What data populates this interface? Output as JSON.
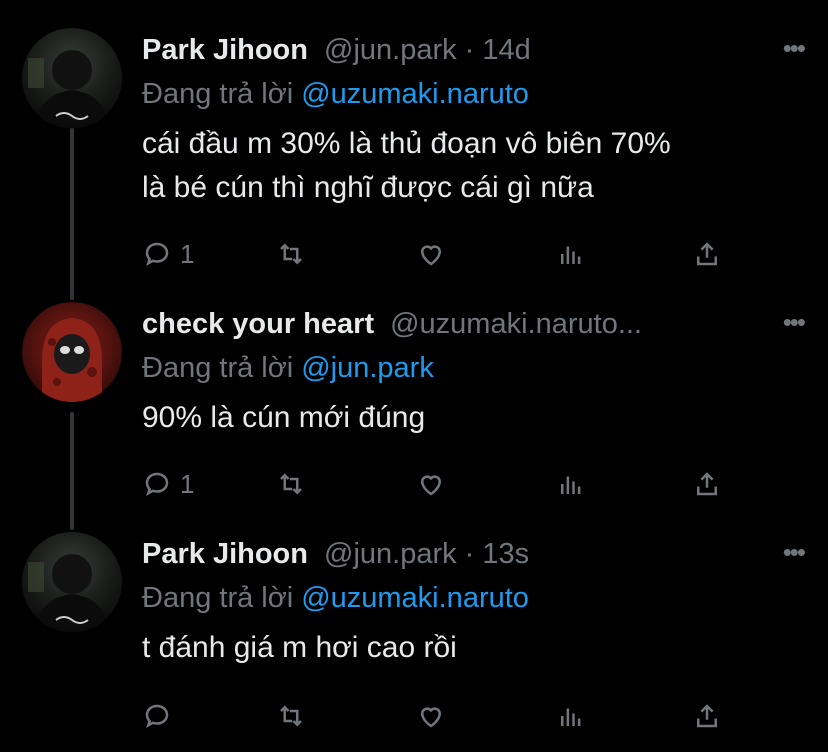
{
  "tweets": [
    {
      "name": "Park Jihoon",
      "handle_meta": "@jun.park · 14d",
      "reply_prefix": "Đang trả lời",
      "reply_mention": "@uzumaki.naruto",
      "lines": [
        "cái đầu m 30% là thủ đoạn vô biên 70%",
        "là bé cún thì nghĩ được cái gì nữa"
      ],
      "reply_count": "1"
    },
    {
      "name": "check your heart",
      "handle_meta": "@uzumaki.naruto...",
      "reply_prefix": "Đang trả lời",
      "reply_mention": "@jun.park",
      "lines": [
        "90% là cún mới đúng"
      ],
      "reply_count": "1"
    },
    {
      "name": "Park Jihoon",
      "handle_meta": "@jun.park · 13s",
      "reply_prefix": "Đang trả lời",
      "reply_mention": "@uzumaki.naruto",
      "lines": [
        "t đánh giá m hơi cao rồi"
      ],
      "reply_count": ""
    }
  ],
  "icons": {
    "reply": "speech-bubble",
    "retweet": "retweet-arrows",
    "like": "heart",
    "views": "bar-chart",
    "share": "upload-arrow",
    "more": "ellipsis"
  },
  "colors": {
    "background": "#000000",
    "text": "#e7e9ea",
    "muted": "#71767b",
    "link": "#1d9bf0"
  }
}
